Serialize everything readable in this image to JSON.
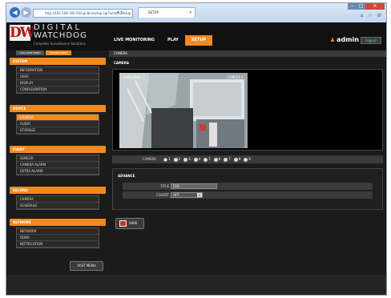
{
  "browser": {
    "address": "http://192.168.100.50/cgi-bin/setup.cgi?action=setup",
    "address_controls": "▾ ↻",
    "tab_title": "SETUP",
    "tab_close": "×",
    "back_glyph": "◀",
    "forward_glyph": "▶",
    "win_min": "–",
    "win_max": "□",
    "win_close": "✕",
    "toolbar_icons": "⌂ ☆ ⚙"
  },
  "header": {
    "logo_mark": "DW",
    "logo_line1": "DIGITAL",
    "logo_line2": "WATCHDOG",
    "logo_tagline": "Complete Surveillance Solutions",
    "tabs": [
      {
        "label": "LIVE MONITORING"
      },
      {
        "label": "PLAY"
      },
      {
        "label": "SETUP"
      }
    ],
    "user_icon": "♟",
    "user": "admin",
    "logout": "Logout"
  },
  "sidebar": {
    "toggles": [
      "COLLAPSE MENU",
      "EXPAND MENU"
    ],
    "groups": [
      {
        "title": "SYSTEM",
        "items": [
          "INFORMATION",
          "USER",
          "DISPLAY",
          "CONFIGURATION"
        ]
      },
      {
        "title": "DEVICE",
        "items": [
          "CAMERA",
          "AUDIO",
          "STORAGE"
        ]
      },
      {
        "title": "EVENT",
        "items": [
          "SENSOR",
          "CAMERA ALARM",
          "EXTRA ALARM"
        ]
      },
      {
        "title": "RECORD",
        "items": [
          "CAMERA",
          "SCHEDULE"
        ]
      },
      {
        "title": "NETWORK",
        "items": [
          "NETWORK",
          "DDNS",
          "NOTIFICATION"
        ]
      }
    ],
    "visit_menu": "VISIT MENU"
  },
  "main": {
    "breadcrumb": "CAMERA",
    "section_title": "CAMERA",
    "video": {
      "label_left": "CH1-CAM1",
      "label_right": "CAMERA 1"
    },
    "camera_selector_label": "CAMERA",
    "cameras": [
      "1",
      "2",
      "3",
      "4",
      "5",
      "6",
      "7",
      "8",
      "9"
    ],
    "selected_camera": "1",
    "advanced": {
      "title": "ADVANCE",
      "title_label": "TITLE",
      "title_value": "CH1",
      "covert_label": "COVERT",
      "covert_value": "OFF"
    },
    "save": "SAVE"
  },
  "colors": {
    "accent": "#f28a1e",
    "background": "#1b1b1b",
    "panel": "#3b3b3b"
  }
}
